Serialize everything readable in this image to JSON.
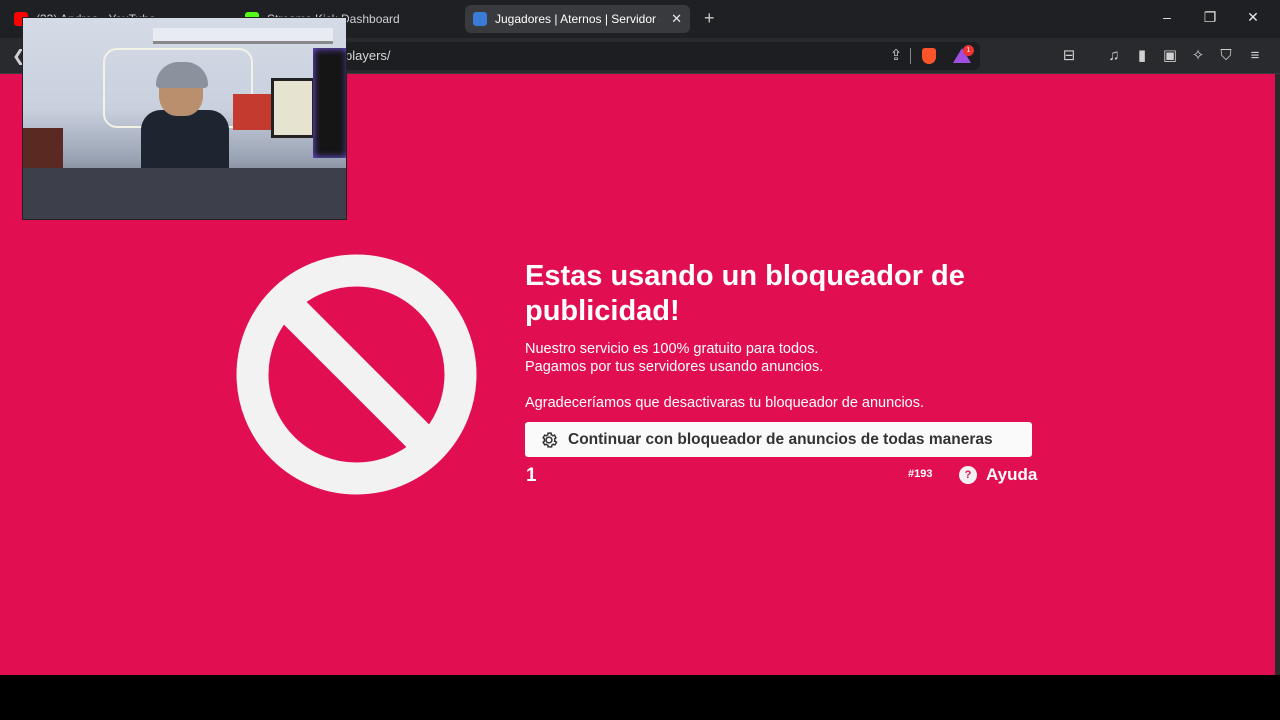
{
  "browser": {
    "tabs": [
      {
        "title": "(33) Andres - YouTube",
        "active": false
      },
      {
        "title": "Streams Kick Dashboard",
        "active": false
      },
      {
        "title": "Jugadores | Aternos | Servidor de",
        "active": true
      }
    ],
    "new_tab_symbol": "+",
    "window_controls": {
      "minimize": "–",
      "restore": "❐",
      "close": "✕"
    },
    "tab_close_symbol": "✕",
    "url_visible": "players/",
    "rewards_badge": "1"
  },
  "page": {
    "headline": "Estas usando un bloqueador de publicidad!",
    "line1": "Nuestro servicio es 100% gratuito para todos.",
    "line2": "Pagamos por tus servidores usando anuncios.",
    "line3": "Agradeceríamos que desactivaras tu bloqueador de anuncios.",
    "continue_button": "Continuar con bloqueador de anuncios de todas maneras",
    "counter": "1",
    "code": "#193",
    "help_label": "Ayuda",
    "help_symbol": "?"
  },
  "colors": {
    "page_background": "#e20e52",
    "icon": "#f2f2f2"
  },
  "icons": [
    "back-arrow-icon",
    "share-icon",
    "brave-shields-icon",
    "brave-rewards-icon",
    "reader-mode-icon",
    "music-icon",
    "sidebar-icon",
    "wallet-icon",
    "leo-icon",
    "vpn-icon",
    "menu-icon",
    "block-icon",
    "gear-icon",
    "help-icon"
  ]
}
